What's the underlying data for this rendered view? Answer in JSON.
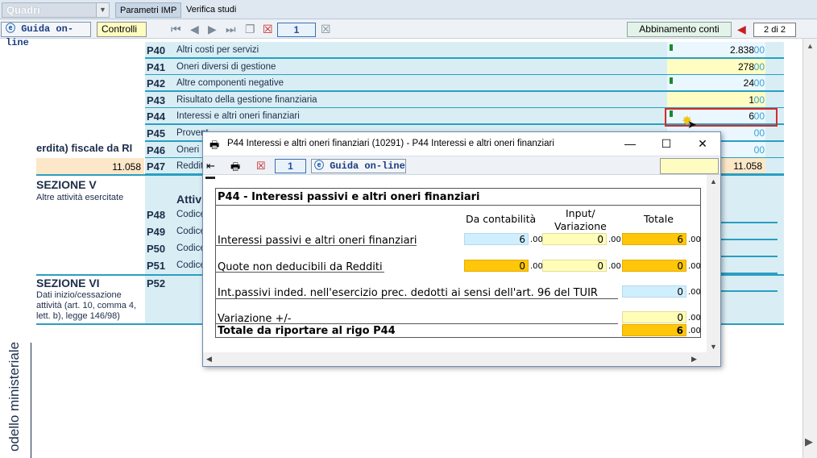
{
  "topbar": {
    "quadri_value": "Quadri",
    "tabs": [
      "Parametri IMP",
      "Verifica studi"
    ]
  },
  "toolbar": {
    "guida_label": "Guida on-line",
    "controlli_label": "Controlli",
    "page_number": "1",
    "abbinamento_label": "Abbinamento conti",
    "page_count": "2 di 2"
  },
  "rows": [
    {
      "code": "P40",
      "desc": "Altri costi per servizi",
      "value": "2.838",
      "cents": "00",
      "style": "cyan",
      "flag": true
    },
    {
      "code": "P41",
      "desc": "Oneri diversi di gestione",
      "value": "278",
      "cents": "00",
      "style": "yellow",
      "flag": false
    },
    {
      "code": "P42",
      "desc": "Altre componenti negative",
      "value": "24",
      "cents": "00",
      "style": "cyan",
      "flag": true
    },
    {
      "code": "P43",
      "desc": "Risultato della gestione finanziaria",
      "value": "1",
      "cents": "00",
      "style": "yellow",
      "flag": false
    },
    {
      "code": "P44",
      "desc": "Interessi e altri oneri finanziari",
      "value": "6",
      "cents": "00",
      "style": "cyan",
      "flag": true
    },
    {
      "code": "P45",
      "desc": "Provent",
      "value": "",
      "cents": "00",
      "style": "cyan",
      "flag": false
    },
    {
      "code": "P46",
      "desc": "Oneri",
      "value": "",
      "cents": "00",
      "style": "cyan",
      "flag": false
    },
    {
      "code": "P47",
      "desc": "Reddit",
      "value": "11.058",
      "cents": "00",
      "style": "orange",
      "flag": false
    }
  ],
  "left": {
    "perdita_label": "erdita) fiscale da RI",
    "perdita_value": "11.058",
    "sezione5_title": "SEZIONE V",
    "sezione5_sub": "Altre attività esercitate",
    "attiv_label": "Attiv",
    "sezione6_title": "SEZIONE VI",
    "sezione6_sub": [
      "Dati inizio/cessazione",
      "attività (art. 10, comma 4,",
      "lett. b), legge 146/98)"
    ],
    "vertical_label": "odello ministeriale"
  },
  "rows2": [
    {
      "code": "P48",
      "desc": "Codice"
    },
    {
      "code": "P49",
      "desc": "Codice"
    },
    {
      "code": "P50",
      "desc": "Codice"
    },
    {
      "code": "P51",
      "desc": "Codice"
    },
    {
      "code": "P52",
      "desc": ""
    }
  ],
  "dialog": {
    "title": "P44 Interessi e altri oneri finanziari (10291) - P44 Interessi e altri oneri finanziari",
    "page_number": "1",
    "guida_label": "Guida on-line",
    "heading": "P44 - Interessi passivi e altri oneri finanziari",
    "col_contabilita": "Da contabilità",
    "col_input": "Input/",
    "col_variazione": "Variazione",
    "col_totale": "Totale",
    "line1_label": "Interessi passivi e altri oneri finanziari",
    "line1_cont": "6",
    "line1_var": "0",
    "line1_tot": "6",
    "line2_label": "Quote non deducibili da Redditi",
    "line2_cont": "0",
    "line2_var": "0",
    "line2_tot": "0",
    "line3_label": "Int.passivi inded. nell'esercizio prec. dedotti ai sensi dell'art. 96 del TUIR",
    "line3_tot": "0",
    "line4_label": "Variazione +/-",
    "line4_tot": "0",
    "line5_label": "Totale da riportare al rigo P44",
    "line5_tot": "6",
    "cents": ".00"
  },
  "colors": {
    "row_bg": "#d9eef4",
    "row_border": "#2a9ec2",
    "cyan_field": "#cfefff",
    "yellow_field": "#fffdb8",
    "orange_field": "#ffc60a",
    "highlight": "#d52b2b"
  }
}
